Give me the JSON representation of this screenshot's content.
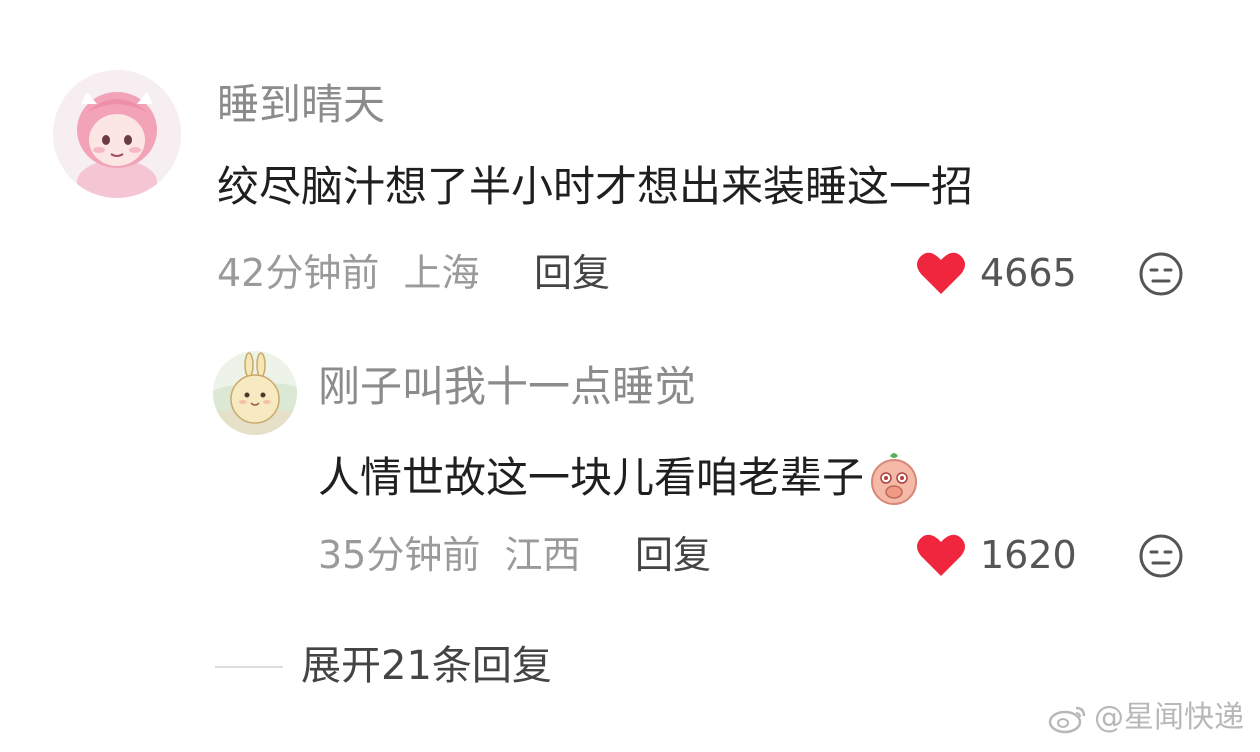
{
  "comment": {
    "username": "睡到晴天",
    "text": "绞尽脑汁想了半小时才想出来装睡这一招",
    "time": "42分钟前",
    "location": "上海",
    "reply_label": "回复",
    "likes": "4665",
    "like_icon": "heart-icon",
    "dislike_icon": "dislike-face-icon"
  },
  "reply": {
    "username": "刚子叫我十一点睡觉",
    "text": "人情世故这一块儿看咱老辈子",
    "emoji": "peach-shy-emoji",
    "time": "35分钟前",
    "location": "江西",
    "reply_label": "回复",
    "likes": "1620"
  },
  "expand_label": "展开21条回复",
  "watermark": "@星闻快递",
  "colors": {
    "heart": "#f0263f",
    "muted_text": "#9a9a9a",
    "body_text": "#1f1f1f"
  }
}
